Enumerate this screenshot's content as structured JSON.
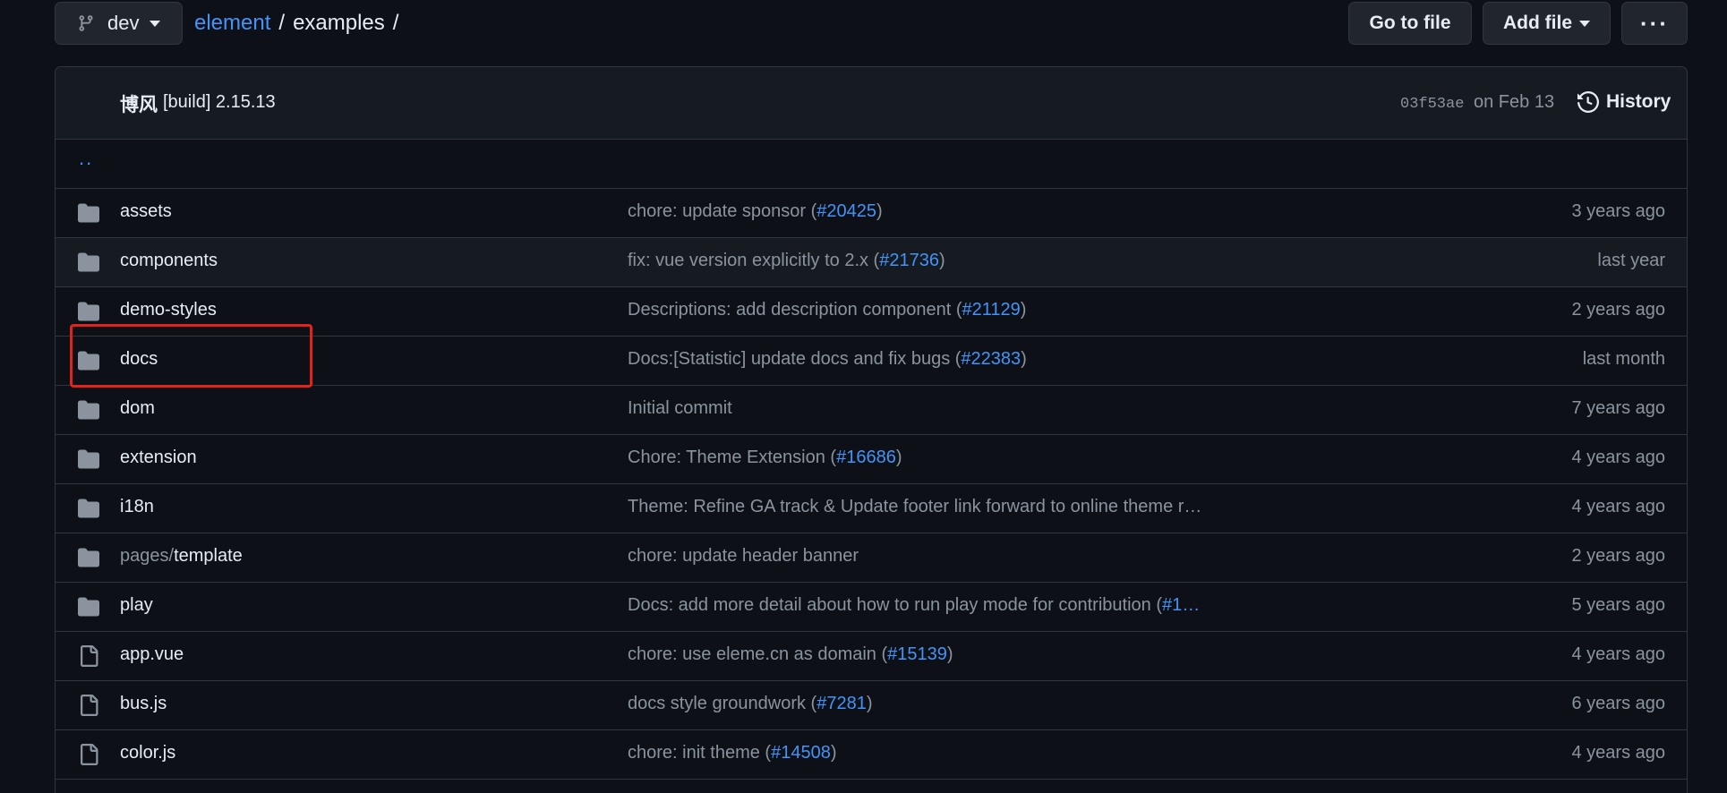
{
  "topbar": {
    "branch": "dev",
    "breadcrumb": {
      "repo": "element",
      "sep1": "/",
      "folder": "examples",
      "sep2": "/"
    },
    "goto_file": "Go to file",
    "add_file": "Add file",
    "more": "···"
  },
  "commit": {
    "author": "博风",
    "message": "[build] 2.15.13",
    "sha": "03f53ae",
    "date": "on Feb 13",
    "history": "History"
  },
  "parent_link": "..",
  "files": [
    {
      "type": "dir",
      "name": "assets",
      "msg": "chore: update sponsor (",
      "pr": "#20425",
      "msg_end": ")",
      "age": "3 years ago"
    },
    {
      "type": "dir",
      "name": "components",
      "msg": "fix: vue version explicitly to 2.x (",
      "pr": "#21736",
      "msg_end": ")",
      "age": "last year"
    },
    {
      "type": "dir",
      "name": "demo-styles",
      "msg": "Descriptions: add description component (",
      "pr": "#21129",
      "msg_end": ")",
      "age": "2 years ago"
    },
    {
      "type": "dir",
      "name": "docs",
      "msg": "Docs:[Statistic] update docs and fix bugs (",
      "pr": "#22383",
      "msg_end": ")",
      "age": "last month"
    },
    {
      "type": "dir",
      "name": "dom",
      "msg": "Initial commit",
      "pr": "",
      "msg_end": "",
      "age": "7 years ago"
    },
    {
      "type": "dir",
      "name": "extension",
      "msg": "Chore: Theme Extension (",
      "pr": "#16686",
      "msg_end": ")",
      "age": "4 years ago"
    },
    {
      "type": "dir",
      "name": "i18n",
      "msg": "Theme: Refine GA track & Update footer link forward to online theme r…",
      "pr": "",
      "msg_end": "",
      "age": "4 years ago"
    },
    {
      "type": "dir",
      "name_prefix": "pages/",
      "name": "template",
      "msg": "chore: update header banner",
      "pr": "",
      "msg_end": "",
      "age": "2 years ago"
    },
    {
      "type": "dir",
      "name": "play",
      "msg": "Docs: add more detail about how to run play mode for contribution (",
      "pr": "#1…",
      "msg_end": "",
      "age": "5 years ago"
    },
    {
      "type": "file",
      "name": "app.vue",
      "msg": "chore: use eleme.cn as domain (",
      "pr": "#15139",
      "msg_end": ")",
      "age": "4 years ago"
    },
    {
      "type": "file",
      "name": "bus.js",
      "msg": "docs style groundwork (",
      "pr": "#7281",
      "msg_end": ")",
      "age": "6 years ago"
    },
    {
      "type": "file",
      "name": "color.js",
      "msg": "chore: init theme (",
      "pr": "#14508",
      "msg_end": ")",
      "age": "4 years ago"
    }
  ],
  "colors": {
    "background": "#0d1117",
    "link": "#4493f8",
    "highlight": "#e3231b"
  }
}
